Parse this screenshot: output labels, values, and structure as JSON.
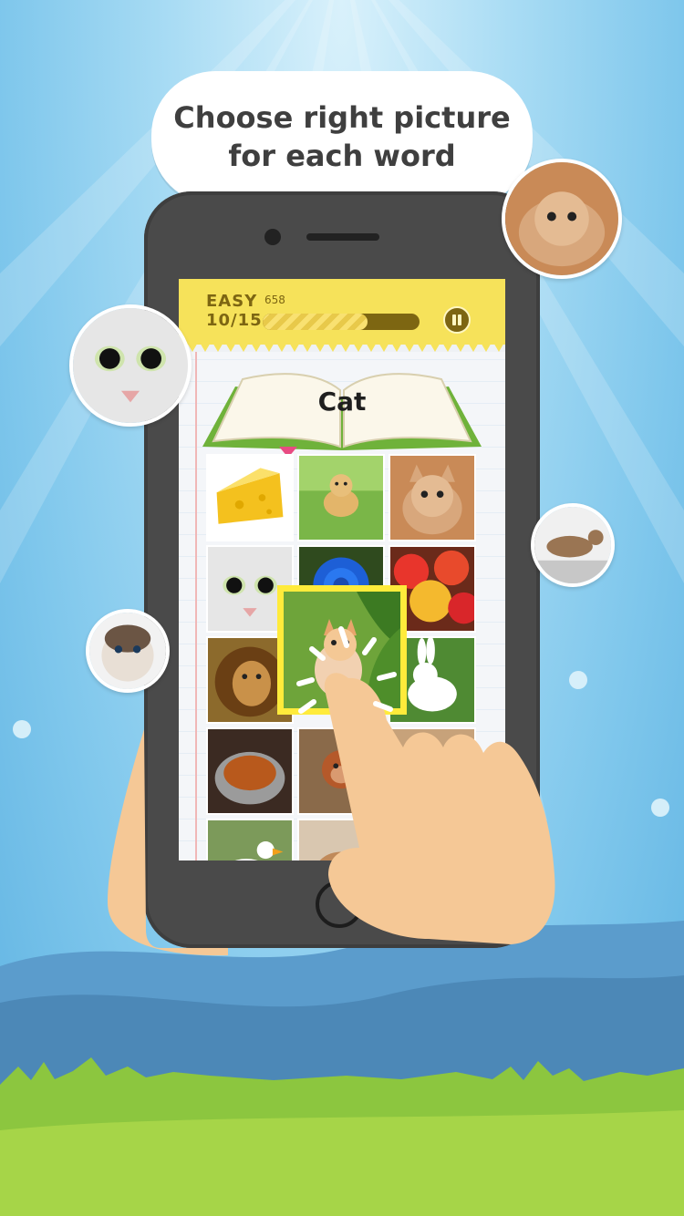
{
  "bubble": {
    "line1": "Choose right picture",
    "line2": "for each word"
  },
  "game": {
    "difficulty": "EASY",
    "progress_text": "10/15",
    "score": "658",
    "progress_fraction": 0.67,
    "word": "Cat"
  },
  "grid": {
    "tiles": [
      "cheese",
      "dog",
      "kitten",
      "cat-face",
      "blue-rose",
      "apples",
      "lion",
      "kitten-in-grass",
      "rabbit",
      "roast-chicken",
      "monkey",
      "mouse",
      "duck",
      "cat-peek"
    ],
    "selected": "kitten-in-grass"
  },
  "colors": {
    "top_bar": "#f6e25a",
    "highlight": "#ffeb3b",
    "phone": "#4a4a4a",
    "sky": "#7fc7ec",
    "grass": "#8cc63f"
  },
  "icons": {
    "pause": "pause-icon",
    "home": "home-button-icon",
    "tap": "hand-pointer-icon"
  }
}
